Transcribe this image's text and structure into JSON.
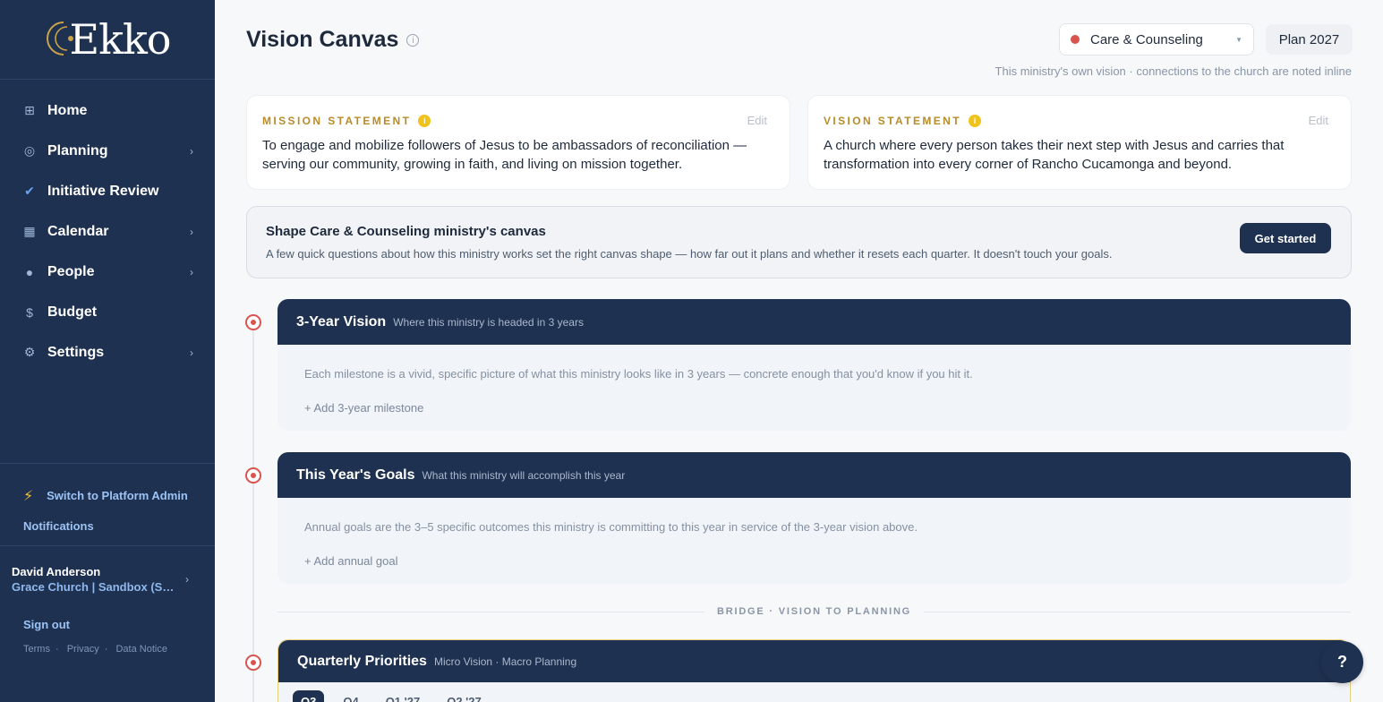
{
  "brand": {
    "name": "Ekko"
  },
  "sidebar": {
    "items": [
      {
        "label": "Home",
        "icon": "grid-icon"
      },
      {
        "label": "Planning",
        "icon": "target-icon"
      },
      {
        "label": "Initiative Review",
        "icon": "check-icon"
      },
      {
        "label": "Calendar",
        "icon": "calendar-icon"
      },
      {
        "label": "People",
        "icon": "person-icon"
      },
      {
        "label": "Budget",
        "icon": "dollar-icon"
      },
      {
        "label": "Settings",
        "icon": "gear-icon"
      }
    ],
    "switch_label": "Switch to Platform Admin",
    "notifications": "Notifications",
    "user_name": "David Anderson",
    "user_org": "Grace Church | Sandbox (Si...",
    "sign_out": "Sign out",
    "terms": "Terms",
    "privacy": "Privacy",
    "data_notice": "Data Notice"
  },
  "header": {
    "title": "Vision Canvas",
    "ministry": "Care & Counseling",
    "plan": "Plan 2027",
    "subnote": "This ministry's own vision · connections to the church are noted inline"
  },
  "mission": {
    "caption": "MISSION STATEMENT",
    "edit": "Edit",
    "text": "To engage and mobilize followers of Jesus to be ambassadors of reconciliation — serving our community, growing in faith, and living on mission together."
  },
  "vision": {
    "caption": "VISION STATEMENT",
    "edit": "Edit",
    "text": "A church where every person takes their next step with Jesus and carries that transformation into every corner of Rancho Cucamonga and beyond."
  },
  "shape": {
    "title": "Shape Care & Counseling ministry's canvas",
    "desc": "A few quick questions about how this ministry works set the right canvas shape — how far out it plans and whether it resets each quarter. It doesn't touch your goals.",
    "button": "Get started"
  },
  "vision3": {
    "title": "3-Year Vision",
    "subtitle": "Where this ministry is headed in 3 years",
    "desc": "Each milestone is a vivid, specific picture of what this ministry looks like in 3 years — concrete enough that you'd know if you hit it.",
    "add": "+ Add 3-year milestone"
  },
  "goals": {
    "title": "This Year's Goals",
    "subtitle": "What this ministry will accomplish this year",
    "desc": "Annual goals are the 3–5 specific outcomes this ministry is committing to this year in service of the 3-year vision above.",
    "add": "+ Add annual goal"
  },
  "bridge": "BRIDGE · VISION TO PLANNING",
  "quarterly": {
    "title": "Quarterly Priorities",
    "subtitle": "Micro Vision · Macro Planning",
    "tabs": [
      "Q3",
      "Q4",
      "Q1 '27",
      "Q2 '27"
    ]
  },
  "help": "?",
  "colors": {
    "sidebar": "#1f3150",
    "accent_gold": "#b98b2a",
    "ministry_dot": "#d9534f"
  }
}
